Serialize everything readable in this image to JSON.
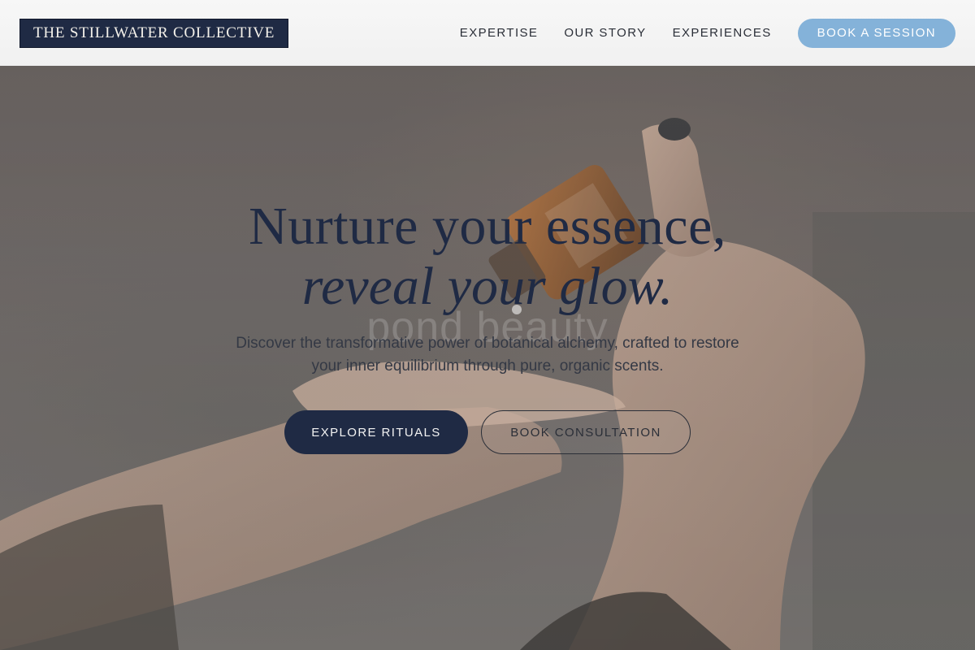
{
  "header": {
    "logo_text": "THE STILLWATER COLLECTIVE",
    "nav": [
      {
        "label": "EXPERTISE"
      },
      {
        "label": "OUR STORY"
      },
      {
        "label": "EXPERIENCES"
      }
    ],
    "cta_label": "BOOK A SESSION"
  },
  "hero": {
    "headline_line1": "Nurture your essence,",
    "headline_line2": "reveal your glow.",
    "watermark": "pond beauty",
    "subtext": "Discover the transformative power of botanical alchemy, crafted to restore your inner equilibrium through pure, organic scents.",
    "primary_button": "EXPLORE RITUALS",
    "secondary_button": "BOOK CONSULTATION"
  },
  "colors": {
    "navy": "#1f2a44",
    "accent_blue": "#84b2d9",
    "header_bg": "#f4f4f4"
  }
}
